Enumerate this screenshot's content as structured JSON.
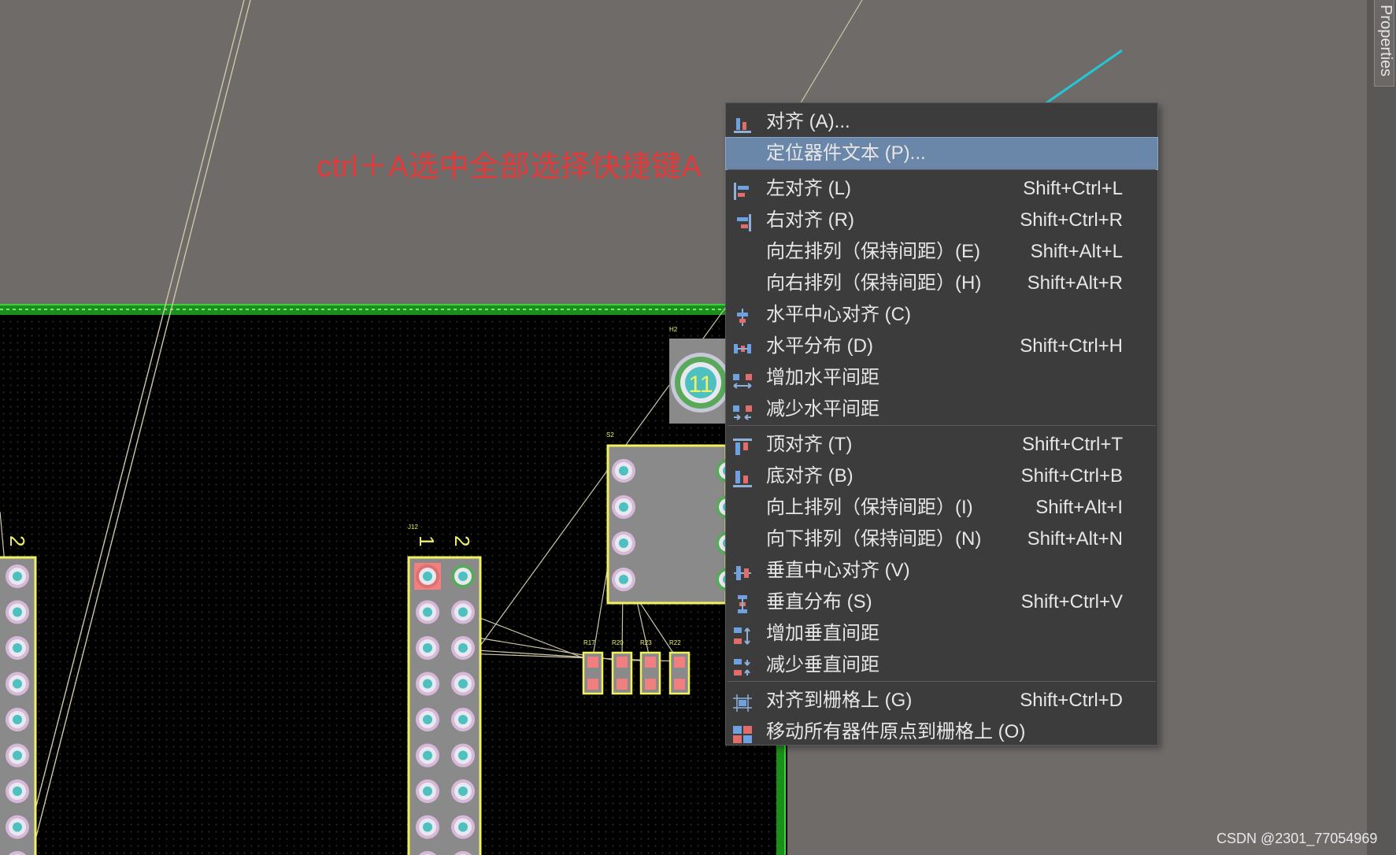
{
  "annotation": "ctrl＋A选中全部选择快捷键A",
  "menu": {
    "items": [
      {
        "label": "对齐 (A)...",
        "shortcut": "",
        "icon": "align-icon"
      },
      {
        "label": "定位器件文本 (P)...",
        "shortcut": "",
        "icon": "",
        "highlighted": true
      },
      {
        "label": "左对齐 (L)",
        "shortcut": "Shift+Ctrl+L",
        "icon": "align-left-icon"
      },
      {
        "label": "右对齐 (R)",
        "shortcut": "Shift+Ctrl+R",
        "icon": "align-right-icon"
      },
      {
        "label": "向左排列（保持间距）(E)",
        "shortcut": "Shift+Alt+L",
        "icon": ""
      },
      {
        "label": "向右排列（保持间距）(H)",
        "shortcut": "Shift+Alt+R",
        "icon": ""
      },
      {
        "label": "水平中心对齐 (C)",
        "shortcut": "",
        "icon": "align-horizontal-center-icon"
      },
      {
        "label": "水平分布 (D)",
        "shortcut": "Shift+Ctrl+H",
        "icon": "distribute-horizontal-icon"
      },
      {
        "label": "增加水平间距",
        "shortcut": "",
        "icon": "increase-horizontal-spacing-icon"
      },
      {
        "label": "减少水平间距",
        "shortcut": "",
        "icon": "decrease-horizontal-spacing-icon"
      },
      {
        "label": "顶对齐 (T)",
        "shortcut": "Shift+Ctrl+T",
        "icon": "align-top-icon"
      },
      {
        "label": "底对齐 (B)",
        "shortcut": "Shift+Ctrl+B",
        "icon": "align-bottom-icon"
      },
      {
        "label": "向上排列（保持间距）(I)",
        "shortcut": "Shift+Alt+I",
        "icon": ""
      },
      {
        "label": "向下排列（保持间距）(N)",
        "shortcut": "Shift+Alt+N",
        "icon": ""
      },
      {
        "label": "垂直中心对齐 (V)",
        "shortcut": "",
        "icon": "align-vertical-center-icon"
      },
      {
        "label": "垂直分布 (S)",
        "shortcut": "Shift+Ctrl+V",
        "icon": "distribute-vertical-icon"
      },
      {
        "label": "增加垂直间距",
        "shortcut": "",
        "icon": "increase-vertical-spacing-icon"
      },
      {
        "label": "减少垂直间距",
        "shortcut": "",
        "icon": "decrease-vertical-spacing-icon"
      },
      {
        "label": "对齐到栅格上 (G)",
        "shortcut": "Shift+Ctrl+D",
        "icon": "align-to-grid-icon"
      },
      {
        "label": "移动所有器件原点到栅格上 (O)",
        "shortcut": "",
        "icon": "move-origins-to-grid-icon"
      }
    ]
  },
  "pcb": {
    "designators": {
      "h2": "H2",
      "s2": "S2",
      "j12": "J12",
      "r17": "R17",
      "r20": "R20",
      "r23": "R23",
      "r22": "R22"
    },
    "pin_labels": {
      "j12_pin1": "1",
      "j12_pin2": "2",
      "left_pin2": "2"
    },
    "mount_hole_label": "11"
  },
  "properties_tab": "Properties",
  "watermark": "CSDN @2301_77054969",
  "colors": {
    "annotation": "#e23a3a",
    "highlight": "#6a86a8",
    "arrow": "#22c8d8",
    "silkscreen": "#f0f060",
    "board_edge": "#1b8f1b"
  }
}
